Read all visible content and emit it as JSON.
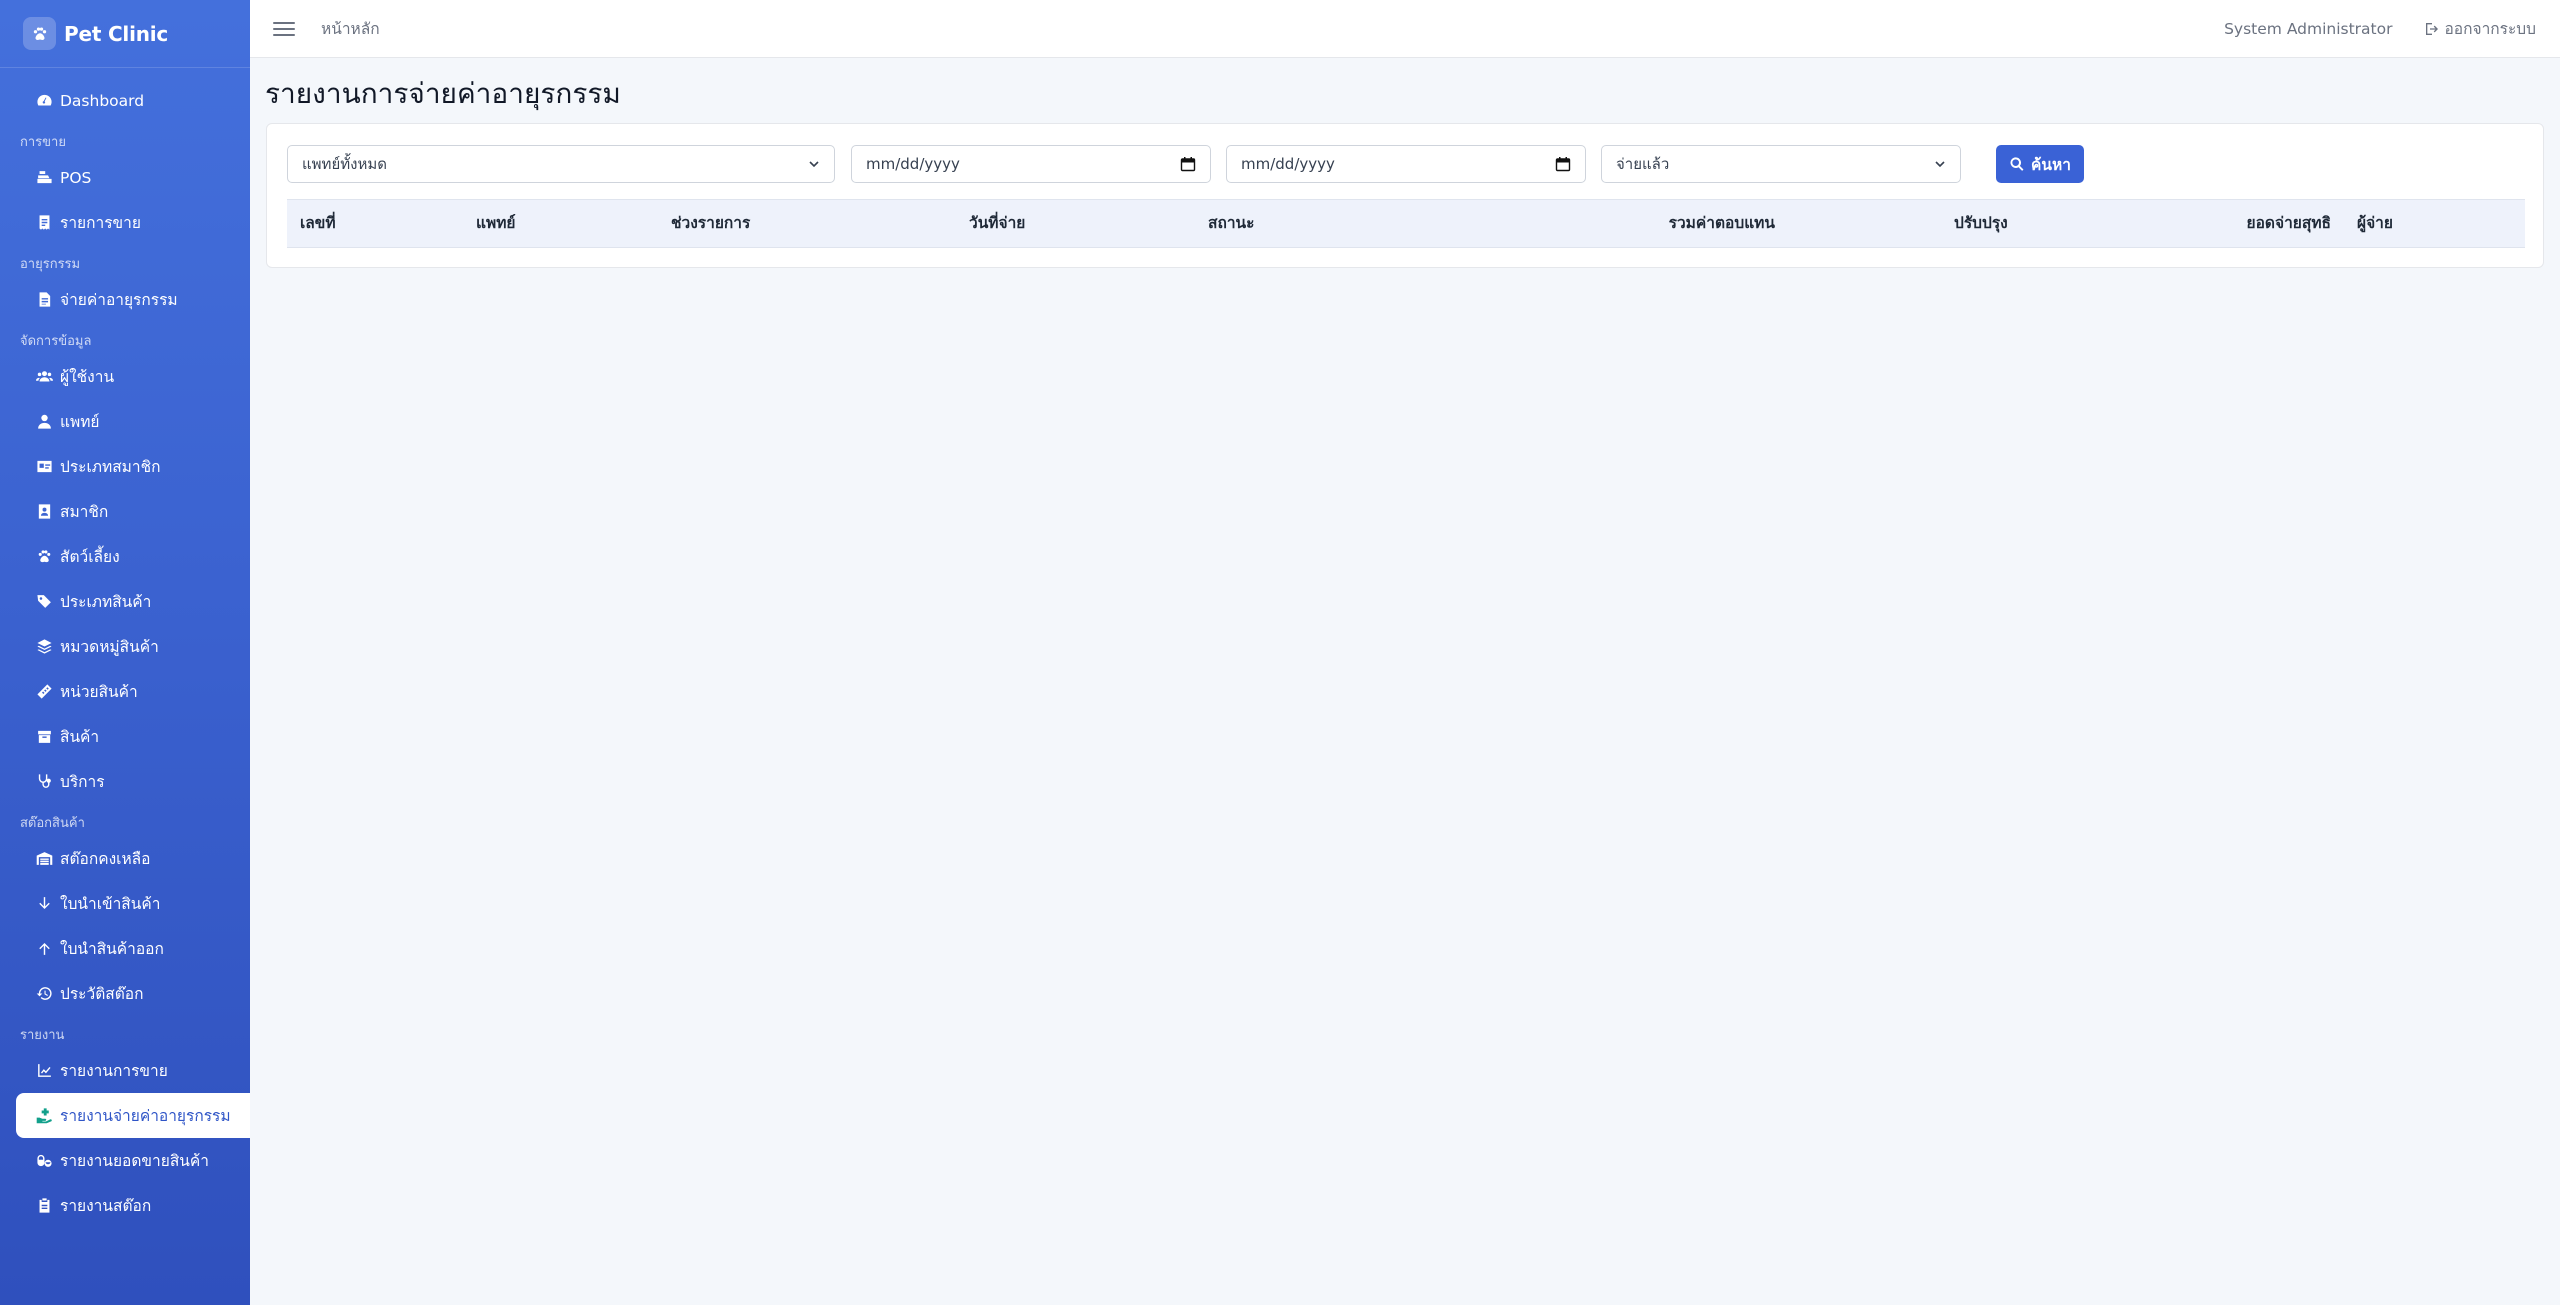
{
  "app": {
    "name": "Pet Clinic"
  },
  "sidebar": {
    "dashboard": "Dashboard",
    "sections": [
      {
        "title": "การขาย",
        "items": [
          "POS",
          "รายการขาย"
        ]
      },
      {
        "title": "อายุรกรรม",
        "items": [
          "จ่ายค่าอายุรกรรม"
        ]
      },
      {
        "title": "จัดการข้อมูล",
        "items": [
          "ผู้ใช้งาน",
          "แพทย์",
          "ประเภทสมาชิก",
          "สมาชิก",
          "สัตว์เลี้ยง",
          "ประเภทสินค้า",
          "หมวดหมู่สินค้า",
          "หน่วยสินค้า",
          "สินค้า",
          "บริการ"
        ]
      },
      {
        "title": "สต๊อกสินค้า",
        "items": [
          "สต๊อกคงเหลือ",
          "ใบนำเข้าสินค้า",
          "ใบนำสินค้าออก",
          "ประวัติสต๊อก"
        ]
      },
      {
        "title": "รายงาน",
        "items": [
          "รายงานการขาย",
          "รายงานจ่ายค่าอายุรกรรม",
          "รายงานยอดขายสินค้า",
          "รายงานสต๊อก"
        ]
      }
    ],
    "active": "รายงานจ่ายค่าอายุรกรรม"
  },
  "topbar": {
    "breadcrumb": "หน้าหลัก",
    "user": "System Administrator",
    "logout": "ออกจากระบบ"
  },
  "page": {
    "title": "รายงานการจ่ายค่าอายุรกรรม"
  },
  "filters": {
    "doctor": "แพทย์ทั้งหมด",
    "date_from": "mm/dd/yyyy",
    "date_to": "mm/dd/yyyy",
    "status": "จ่ายแล้ว",
    "search_label": "ค้นหา"
  },
  "table": {
    "columns": [
      "เลขที่",
      "แพทย์",
      "ช่วงรายการ",
      "วันที่จ่าย",
      "สถานะ",
      "รวมค่าตอบแทน",
      "ปรับปรุง",
      "ยอดจ่ายสุทธิ",
      "ผู้จ่าย"
    ]
  },
  "colors": {
    "sidebar": "#3b62d0",
    "accent": "#3a62d6",
    "active_icon": "#12a08b"
  }
}
